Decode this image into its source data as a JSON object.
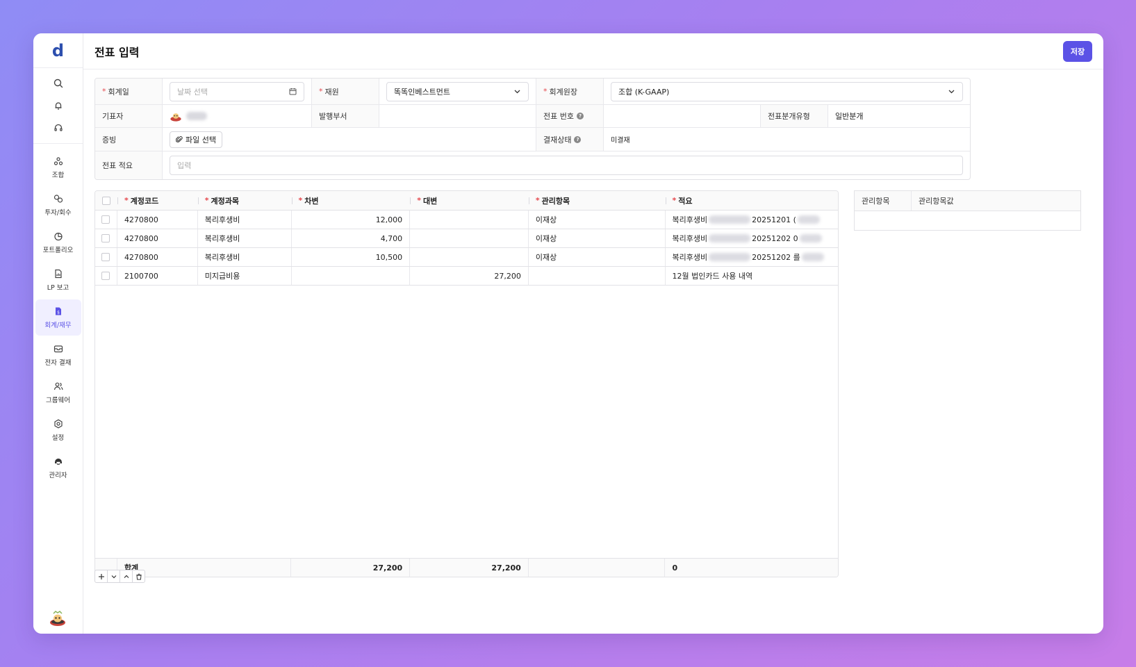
{
  "app": {
    "logo": "d"
  },
  "header": {
    "title": "전표 입력",
    "save_label": "저장"
  },
  "sidebar": {
    "items": [
      {
        "label": "조합",
        "icon": "union-icon"
      },
      {
        "label": "투자/회수",
        "icon": "invest-icon"
      },
      {
        "label": "포트폴리오",
        "icon": "portfolio-icon"
      },
      {
        "label": "LP 보고",
        "icon": "report-icon"
      },
      {
        "label": "회계/재무",
        "icon": "accounting-icon",
        "active": true
      },
      {
        "label": "전자 결재",
        "icon": "approval-icon"
      },
      {
        "label": "그룹웨어",
        "icon": "groupware-icon"
      },
      {
        "label": "설정",
        "icon": "settings-icon"
      },
      {
        "label": "관리자",
        "icon": "admin-icon"
      }
    ]
  },
  "form": {
    "date_label": "회계일",
    "date_placeholder": "날짜 선택",
    "fund_label": "재원",
    "fund_value": "똑똑인베스트먼트",
    "ledger_label": "회계원장",
    "ledger_value": "조합 (K-GAAP)",
    "writer_label": "기표자",
    "dept_label": "발행부서",
    "voucher_no_label": "전표 번호",
    "voucher_type_label": "전표분개유형",
    "voucher_type_value": "일반분개",
    "evidence_label": "증빙",
    "file_button": "파일 선택",
    "approval_label": "결재상태",
    "approval_value": "미결재",
    "summary_label": "전표 적요",
    "summary_placeholder": "입력"
  },
  "table": {
    "headers": {
      "code": "계정코드",
      "account": "계정과목",
      "debit": "차변",
      "credit": "대변",
      "mgmt": "관리항목",
      "memo": "적요"
    },
    "rows": [
      {
        "code": "4270800",
        "account": "복리후생비",
        "debit": "12,000",
        "credit": "",
        "mgmt": "이재상",
        "memo": "복리후생비",
        "memo_date": "20251201 ("
      },
      {
        "code": "4270800",
        "account": "복리후생비",
        "debit": "4,700",
        "credit": "",
        "mgmt": "이재상",
        "memo": "복리후생비",
        "memo_date": "20251202 0"
      },
      {
        "code": "4270800",
        "account": "복리후생비",
        "debit": "10,500",
        "credit": "",
        "mgmt": "이재상",
        "memo": "복리후생비",
        "memo_date": "20251202 를"
      },
      {
        "code": "2100700",
        "account": "미지급비용",
        "debit": "",
        "credit": "27,200",
        "mgmt": "",
        "memo": "12월 법인카드 사용 내역",
        "memo_date": ""
      }
    ],
    "footer": {
      "label": "합계",
      "debit_total": "27,200",
      "credit_total": "27,200",
      "diff": "0"
    }
  },
  "side_panel": {
    "col1": "관리항목",
    "col2": "관리항목값"
  }
}
